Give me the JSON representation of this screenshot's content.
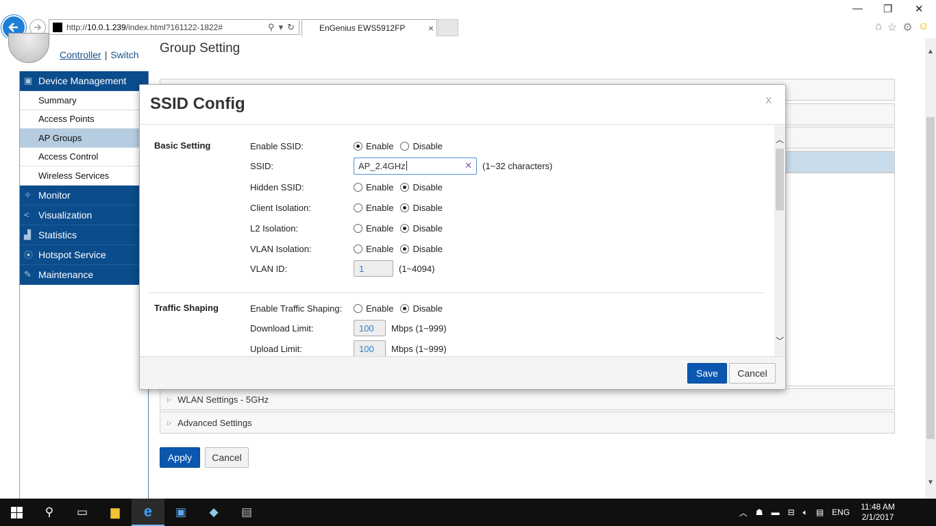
{
  "browser": {
    "url_prefix": "http://",
    "url_host": "10.0.1.239",
    "url_path": "/index.html?161122-1822#",
    "tab_title": "EnGenius EWS5912FP",
    "tab_close": "×"
  },
  "header": {
    "controller": "Controller",
    "separator": "|",
    "switch": "Switch",
    "page_title": "Group Setting"
  },
  "sidebar": {
    "sections": [
      {
        "label": "Device Management",
        "icon": "device-icon"
      },
      {
        "label": "Monitor",
        "icon": "monitor-icon"
      },
      {
        "label": "Visualization",
        "icon": "share-icon"
      },
      {
        "label": "Statistics",
        "icon": "chart-icon"
      },
      {
        "label": "Hotspot Service",
        "icon": "wifi-icon"
      },
      {
        "label": "Maintenance",
        "icon": "wrench-icon"
      }
    ],
    "items": [
      "Summary",
      "Access Points",
      "AP Groups",
      "Access Control",
      "Wireless Services"
    ],
    "active_item": "AP Groups"
  },
  "accordion": {
    "wlan_5g": "WLAN Settings - 5GHz",
    "advanced": "Advanced Settings"
  },
  "page_buttons": {
    "apply": "Apply",
    "cancel": "Cancel"
  },
  "modal": {
    "title": "SSID Config",
    "close": "x",
    "basic_setting": "Basic Setting",
    "traffic_shaping": "Traffic Shaping",
    "enable": "Enable",
    "disable": "Disable",
    "rows": {
      "enable_ssid": {
        "label": "Enable SSID:",
        "selected": "Enable"
      },
      "ssid": {
        "label": "SSID:",
        "value": "AP_2.4GHz",
        "hint": "(1~32 characters)"
      },
      "hidden_ssid": {
        "label": "Hidden SSID:",
        "selected": "Disable"
      },
      "client_isolation": {
        "label": "Client Isolation:",
        "selected": "Disable"
      },
      "l2_isolation": {
        "label": "L2 Isolation:",
        "selected": "Disable"
      },
      "vlan_isolation": {
        "label": "VLAN Isolation:",
        "selected": "Disable"
      },
      "vlan_id": {
        "label": "VLAN ID:",
        "value": "1",
        "hint": "(1~4094)"
      },
      "enable_traffic_shaping": {
        "label": "Enable Traffic Shaping:",
        "selected": "Disable"
      },
      "download_limit": {
        "label": "Download Limit:",
        "value": "100",
        "hint": "Mbps (1~999)"
      },
      "upload_limit": {
        "label": "Upload Limit:",
        "value": "100",
        "hint": "Mbps (1~999)"
      }
    },
    "save": "Save",
    "cancel": "Cancel"
  },
  "taskbar": {
    "language": "ENG",
    "time": "11:48 AM",
    "date": "2/1/2017"
  },
  "colors": {
    "accent": "#0b57b0",
    "sidebar_section": "#0b4c8c",
    "sidebar_active": "#b6cce0"
  }
}
